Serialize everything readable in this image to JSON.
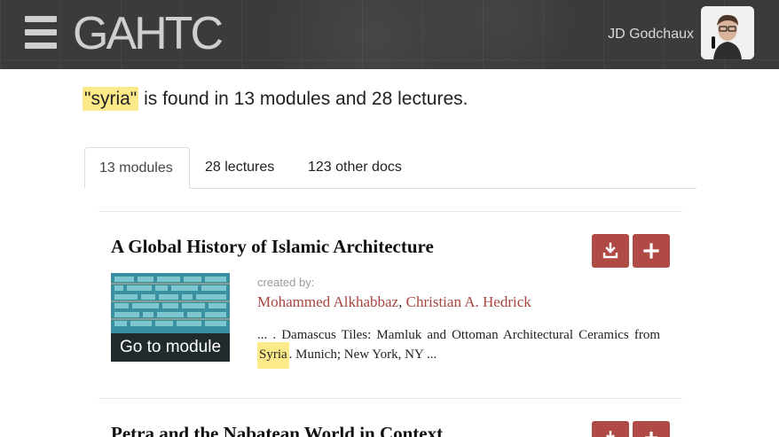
{
  "header": {
    "logo": "GAHTC",
    "user_name": "JD Godchaux"
  },
  "summary": {
    "query": "\"syria\"",
    "text": " is found in 13 modules and 28 lectures."
  },
  "tabs": [
    {
      "label": "13 modules",
      "active": true
    },
    {
      "label": "28 lectures",
      "active": false
    },
    {
      "label": "123 other docs",
      "active": false
    }
  ],
  "results": [
    {
      "title": "A Global History of Islamic Architecture",
      "thumb_caption": "Go to module",
      "created_by_label": "created by:",
      "authors": [
        "Mohammed Alkhabbaz",
        "Christian A. Hedrick"
      ],
      "author_separator": ", ",
      "excerpt_before": "... . Damascus Tiles: Mamluk and Ottoman Architectural Ceramics from ",
      "excerpt_match": "Syria",
      "excerpt_after": ". Munich; New York, NY ..."
    },
    {
      "title": "Petra and the Nabatean World in Context"
    }
  ],
  "icons": {
    "menu": "hamburger-icon",
    "download": "download-icon",
    "add": "plus-icon"
  },
  "colors": {
    "header_bg": "#3b3b3b",
    "highlight": "#fce98a",
    "button": "#b04a45",
    "author_link": "#a8453f"
  }
}
